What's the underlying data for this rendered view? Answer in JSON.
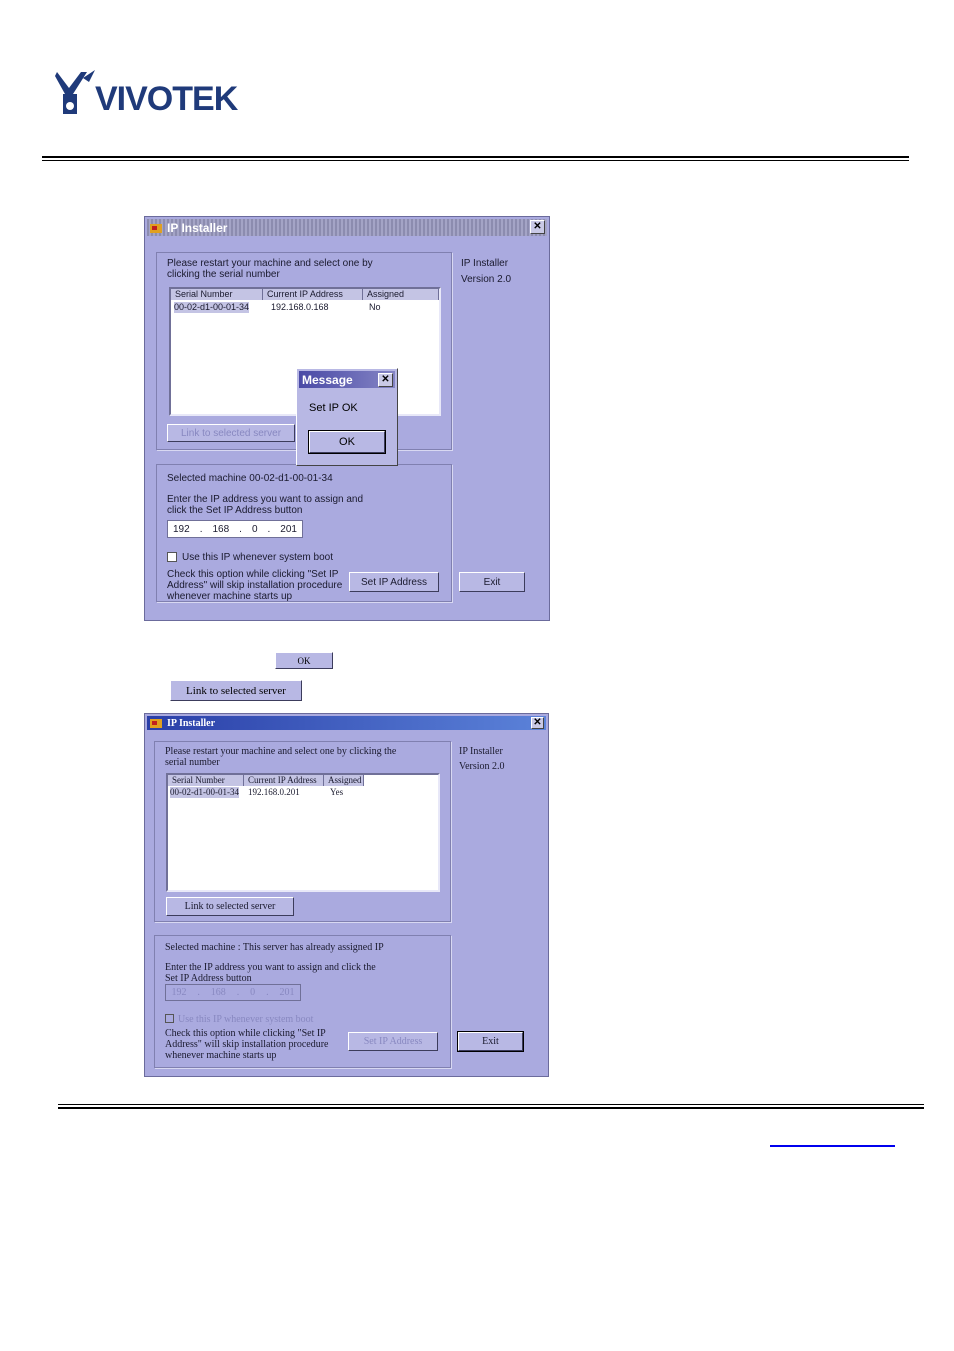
{
  "brand": {
    "name": "VIVOTEK"
  },
  "window1": {
    "title": "IP Installer",
    "close": "✕",
    "instructions": "Please restart your machine and select one by\nclicking the serial number",
    "info_title": "IP Installer",
    "info_version": "Version 2.0",
    "columns": [
      "Serial Number",
      "Current IP Address",
      "Assigned"
    ],
    "row": {
      "serial": "00-02-d1-00-01-34",
      "ip": "192.168.0.168",
      "assigned": "No"
    },
    "link_button": "Link to selected server",
    "selected_machine": "Selected machine 00-02-d1-00-01-34",
    "enter_ip": "Enter the IP address you want to assign and\nclick the Set IP Address button",
    "ip_octets": [
      "192",
      "168",
      "0",
      "201"
    ],
    "ip_sep": ".",
    "checkbox_label": "Use this IP whenever system boot",
    "check_note": "Check this option while clicking \"Set IP\nAddress\" will skip installation procedure\nwhenever machine starts up",
    "set_ip_button": "Set IP Address",
    "exit_button": "Exit"
  },
  "message": {
    "title": "Message",
    "close": "✕",
    "text": "Set IP OK",
    "ok": "OK"
  },
  "inline": {
    "ok_button": "OK",
    "link_button": "Link to selected server"
  },
  "window2": {
    "title": "IP Installer",
    "close": "✕",
    "instructions": "Please restart your machine and select one by clicking the\nserial number",
    "info_title": "IP Installer",
    "info_version": "Version 2.0",
    "columns": [
      "Serial Number",
      "Current IP Address",
      "Assigned"
    ],
    "row": {
      "serial": "00-02-d1-00-01-34",
      "ip": "192.168.0.201",
      "assigned": "Yes"
    },
    "link_button": "Link to selected server",
    "selected_machine": "Selected machine : This server has already assigned IP",
    "enter_ip": "Enter the IP address you want to assign and click the\nSet IP Address button",
    "ip_octets": [
      "192",
      "168",
      "0",
      "201"
    ],
    "ip_sep": ".",
    "checkbox_label": "Use this IP whenever system boot",
    "check_note": "Check this option while clicking \"Set IP\nAddress\" will skip installation procedure\nwhenever machine starts up",
    "set_ip_button": "Set IP Address",
    "exit_button": "Exit"
  },
  "colors": {
    "window_bg": "#aaaadf",
    "brand": "#1f3a7a",
    "link": "#0000ee"
  }
}
